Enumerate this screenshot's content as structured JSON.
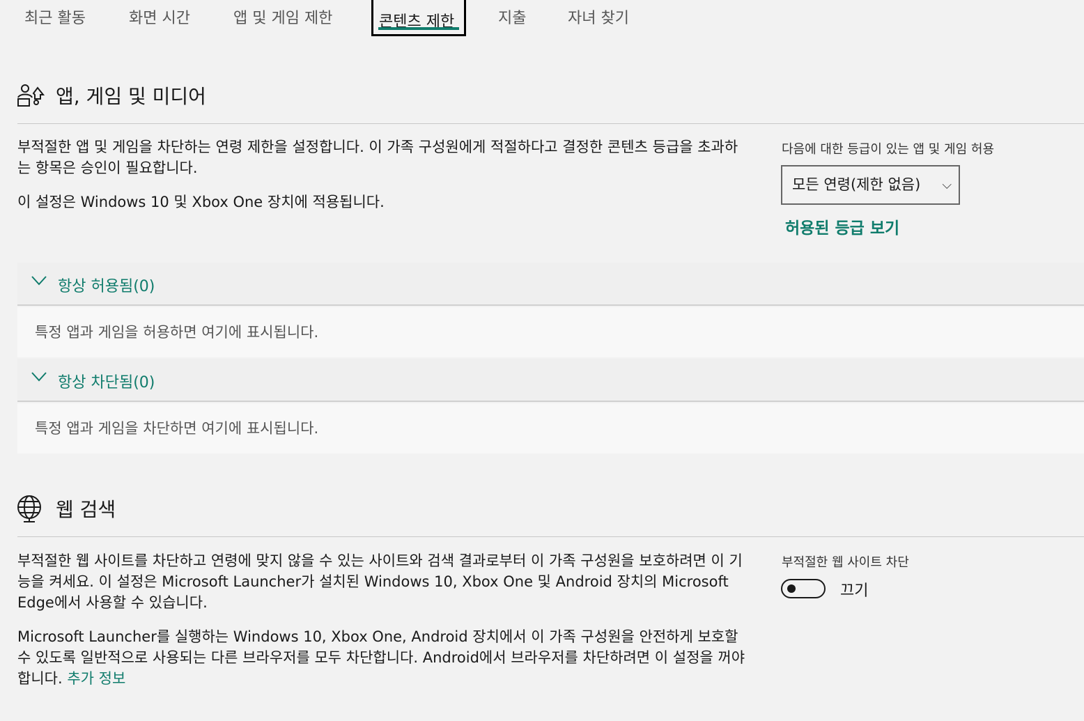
{
  "tabs": [
    {
      "label": "최근 활동"
    },
    {
      "label": "화면 시간"
    },
    {
      "label": "앱 및 게임 제한"
    },
    {
      "label": "콘텐츠 제한"
    },
    {
      "label": "지출"
    },
    {
      "label": "자녀 찾기"
    }
  ],
  "active_tab": "콘텐츠 제한",
  "apps_section": {
    "title": "앱, 게임 및 미디어",
    "icon": "apps-games-media-icon",
    "description_1": "부적절한 앱 및 게임을 차단하는 연령 제한을 설정합니다. 이 가족 구성원에게 적절하다고 결정한 콘텐츠 등급을 초과하는 항목은 승인이 필요합니다.",
    "description_2": "이 설정은 Windows 10 및 Xbox One 장치에 적용됩니다.",
    "rating_label": "다음에 대한 등급이 있는 앱 및 게임 허용",
    "rating_value": "모든 연령(제한 없음)",
    "view_ratings_link": "허용된 등급 보기",
    "always_allowed": {
      "label": "항상 허용됨(0)",
      "empty_text": "특정 앱과 게임을 허용하면 여기에 표시됩니다."
    },
    "always_blocked": {
      "label": "항상 차단됨(0)",
      "empty_text": "특정 앱과 게임을 차단하면 여기에 표시됩니다."
    }
  },
  "web_section": {
    "title": "웹 검색",
    "icon": "globe-icon",
    "description_1": "부적절한 웹 사이트를 차단하고 연령에 맞지 않을 수 있는 사이트와 검색 결과로부터 이 가족 구성원을 보호하려면 이 기능을 켜세요. 이 설정은 Microsoft Launcher가 설치된 Windows 10, Xbox One 및 Android 장치의 Microsoft Edge에서 사용할 수 있습니다.",
    "description_2": "Microsoft Launcher를 실행하는 Windows 10, Xbox One, Android 장치에서 이 가족 구성원을 안전하게 보호할 수 있도록 일반적으로 사용되는 다른 브라우저를 모두 차단합니다. Android에서 브라우저를 차단하려면 이 설정을 꺼야 합니다.",
    "more_info_link": "추가 정보",
    "block_label": "부적절한 웹 사이트 차단",
    "toggle_state": "끄기"
  },
  "colors": {
    "accent": "#107c6c",
    "background": "#f2f2f2"
  }
}
